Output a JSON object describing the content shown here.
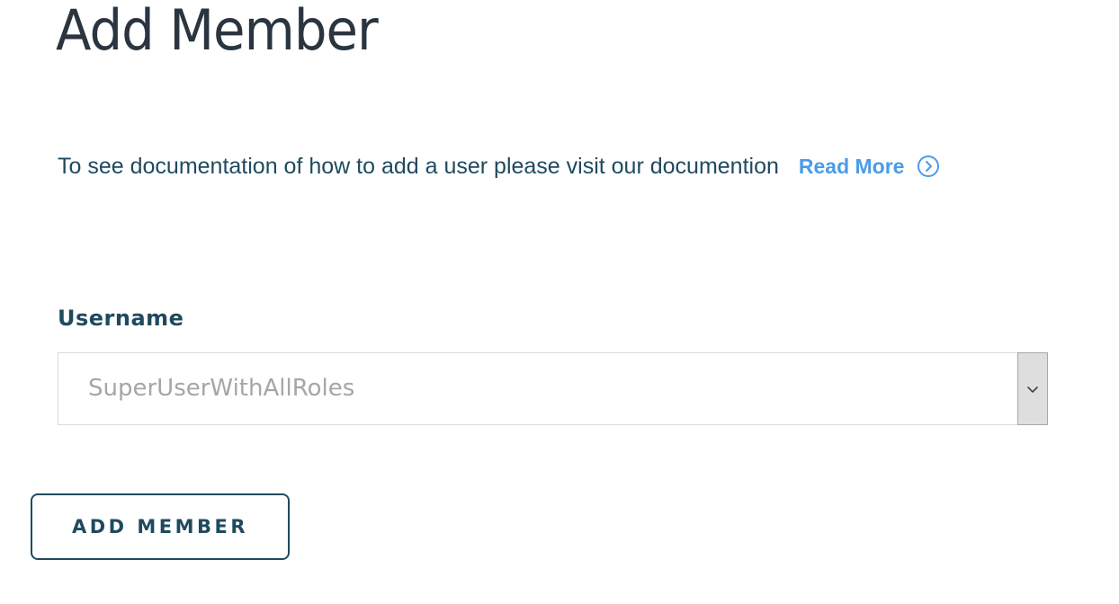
{
  "page": {
    "title": "Add Member"
  },
  "documentation": {
    "text": "To see documentation of how to add a user please visit our documention",
    "link_label": "Read More",
    "link_icon": "chevron-right-circle-icon"
  },
  "form": {
    "username_label": "Username",
    "username_selected": "SuperUserWithAllRoles",
    "dropdown_icon": "chevron-down-icon"
  },
  "actions": {
    "add_member_label": "ADD MEMBER"
  },
  "colors": {
    "title": "#2a3540",
    "text": "#1f4a5e",
    "link": "#4a9be8",
    "placeholder": "#a6a6a6",
    "border": "#d8dde0"
  }
}
